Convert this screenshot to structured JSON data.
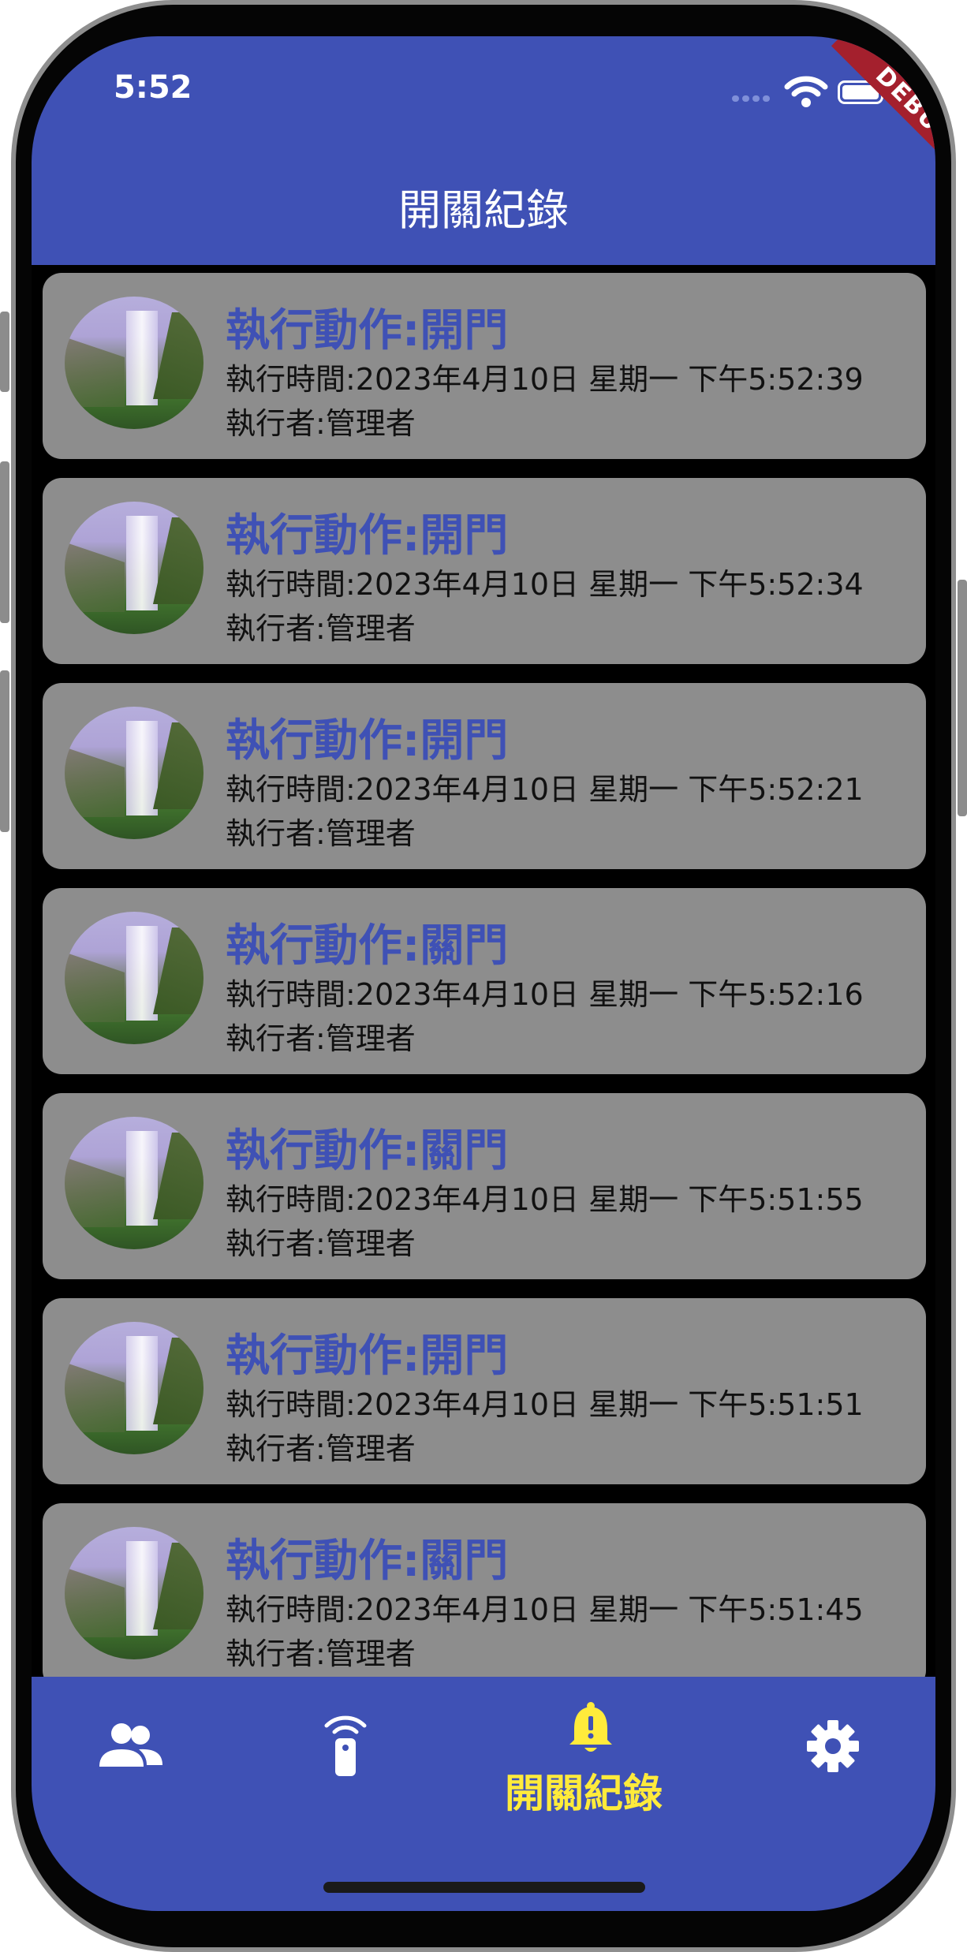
{
  "status_bar": {
    "time": "5:52",
    "debug_label": "DEBUG"
  },
  "header": {
    "title": "開關紀錄"
  },
  "records": [
    {
      "action": "執行動作:開門",
      "time": "執行時間:2023年4月10日 星期一 下午5:52:39",
      "operator": "執行者:管理者"
    },
    {
      "action": "執行動作:開門",
      "time": "執行時間:2023年4月10日 星期一 下午5:52:34",
      "operator": "執行者:管理者"
    },
    {
      "action": "執行動作:開門",
      "time": "執行時間:2023年4月10日 星期一 下午5:52:21",
      "operator": "執行者:管理者"
    },
    {
      "action": "執行動作:關門",
      "time": "執行時間:2023年4月10日 星期一 下午5:52:16",
      "operator": "執行者:管理者"
    },
    {
      "action": "執行動作:關門",
      "time": "執行時間:2023年4月10日 星期一 下午5:51:55",
      "operator": "執行者:管理者"
    },
    {
      "action": "執行動作:開門",
      "time": "執行時間:2023年4月10日 星期一 下午5:51:51",
      "operator": "執行者:管理者"
    },
    {
      "action": "執行動作:關門",
      "time": "執行時間:2023年4月10日 星期一 下午5:51:45",
      "operator": "執行者:管理者"
    }
  ],
  "bottom_nav": {
    "items": [
      {
        "icon": "people-icon",
        "label": ""
      },
      {
        "icon": "remote-control-icon",
        "label": ""
      },
      {
        "icon": "bell-alert-icon",
        "label": "開關紀錄",
        "active": true
      },
      {
        "icon": "gear-icon",
        "label": ""
      }
    ],
    "active_color": "#ffeb3b",
    "inactive_color": "#ffffff"
  },
  "colors": {
    "primary": "#3f51b5",
    "card_background": "#8d8d8d",
    "list_background": "#000000",
    "debug_banner": "#a4202d"
  }
}
